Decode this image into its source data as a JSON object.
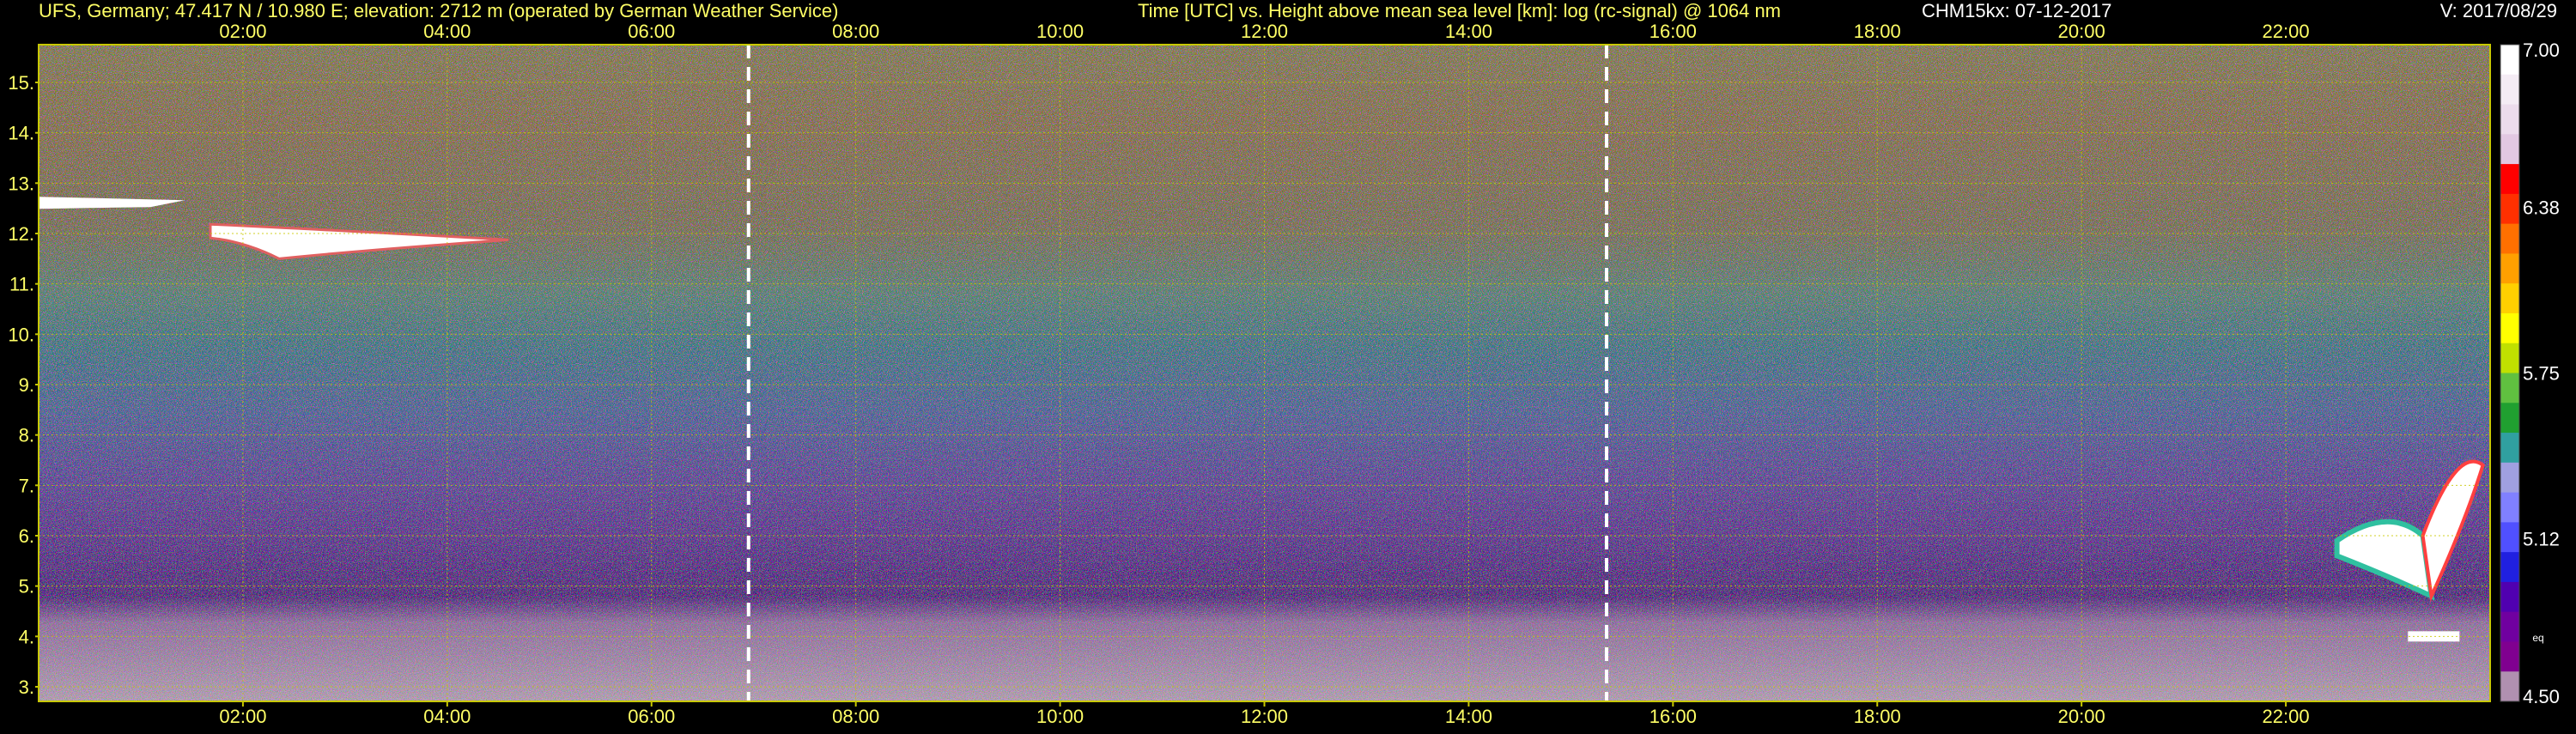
{
  "header": {
    "station": "UFS, Germany; 47.417 N / 10.980 E; elevation: 2712 m  (operated by German Weather Service)",
    "axes_description": "Time [UTC] vs. Height above mean sea level [km]: log (rc-signal) @ 1064 nm",
    "instrument_date": "CHM15kx: 07-12-2017",
    "version": "V: 2017/08/29"
  },
  "colors": {
    "background": "#000000",
    "text": "#ffff66",
    "grid": "#c8c800",
    "marker_line": "#ffffff",
    "ground_band": "#b09ab0"
  },
  "chart_data": {
    "type": "heatmap",
    "title": "Time [UTC] vs. Height above mean sea level [km]: log (rc-signal) @ 1064 nm",
    "xlabel": "Time [UTC]",
    "ylabel": "Height above mean sea level [km]",
    "x_ticks": [
      "02:00",
      "04:00",
      "06:00",
      "08:00",
      "10:00",
      "12:00",
      "14:00",
      "16:00",
      "18:00",
      "20:00",
      "22:00"
    ],
    "x_tick_hours": [
      2,
      4,
      6,
      8,
      10,
      12,
      14,
      16,
      18,
      20,
      22
    ],
    "xlim_hours": [
      0,
      24
    ],
    "y_ticks": [
      "3.",
      "4.",
      "5.",
      "6.",
      "7.",
      "8.",
      "9.",
      "10.",
      "11.",
      "12.",
      "13.",
      "14.",
      "15."
    ],
    "y_tick_values": [
      3,
      4,
      5,
      6,
      7,
      8,
      9,
      10,
      11,
      12,
      13,
      14,
      15
    ],
    "ylim_km": [
      2.71,
      15.75
    ],
    "grid": true,
    "vertical_markers_hours": [
      6.95,
      15.35
    ],
    "colorbar": {
      "labels": [
        "7.00",
        "6.38",
        "5.75",
        "5.12",
        "4.50"
      ],
      "values": [
        7.0,
        6.38,
        5.75,
        5.12,
        4.5
      ],
      "range": [
        4.5,
        7.0
      ],
      "unit_label": "eq",
      "colors_top_to_bottom": [
        "#ffffff",
        "#f4ecf4",
        "#ecdcec",
        "#e2c8e2",
        "#ff0000",
        "#ff3000",
        "#ff7000",
        "#ffa000",
        "#ffd000",
        "#ffff00",
        "#c0e000",
        "#60c040",
        "#20a030",
        "#30a0a0",
        "#a0a0e0",
        "#8080ff",
        "#5050ff",
        "#2020e0",
        "#5000b0",
        "#7000a0",
        "#800090",
        "#b090b0"
      ]
    },
    "features": [
      {
        "name": "cirrus",
        "time_start_hours": 0.0,
        "time_end_hours": 4.6,
        "height_km": [
          11.5,
          12.9
        ]
      },
      {
        "name": "cloud",
        "time_start_hours": 22.5,
        "time_end_hours": 23.7,
        "height_km": [
          4.0,
          7.6
        ]
      }
    ]
  }
}
